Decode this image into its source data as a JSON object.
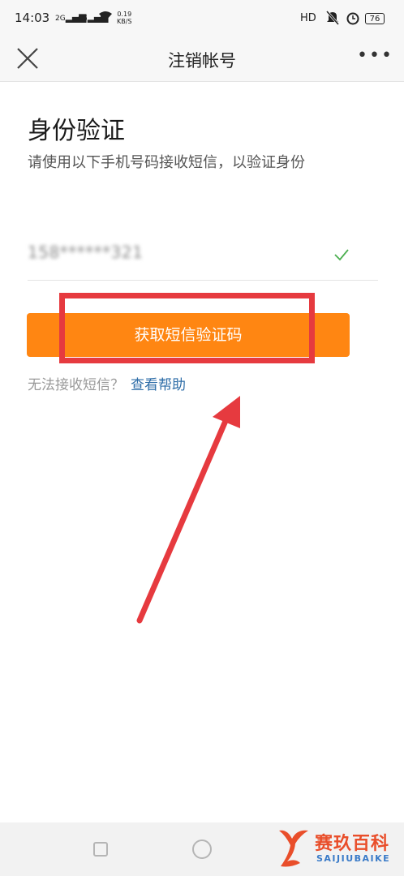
{
  "status_bar": {
    "time": "14:03",
    "signal_1": "2G",
    "signal_2": "4G",
    "speed_value": "0.19",
    "speed_unit": "KB/S",
    "hd": "HD",
    "battery": "76"
  },
  "header": {
    "title": "注销帐号",
    "more": "•••"
  },
  "content": {
    "title": "身份验证",
    "subtitle": "请使用以下手机号码接收短信，以验证身份",
    "phone": "158******321",
    "sms_button_label": "获取短信验证码",
    "help_question": "无法接收短信？",
    "help_link": "查看帮助"
  },
  "watermark": {
    "brand": "赛玖百科",
    "brand_sub": "SAIJIUBAIKE"
  },
  "colors": {
    "accent": "#ff8612",
    "link": "#2f6ea8",
    "annotation": "#e63a3f",
    "check": "#4caf50"
  }
}
